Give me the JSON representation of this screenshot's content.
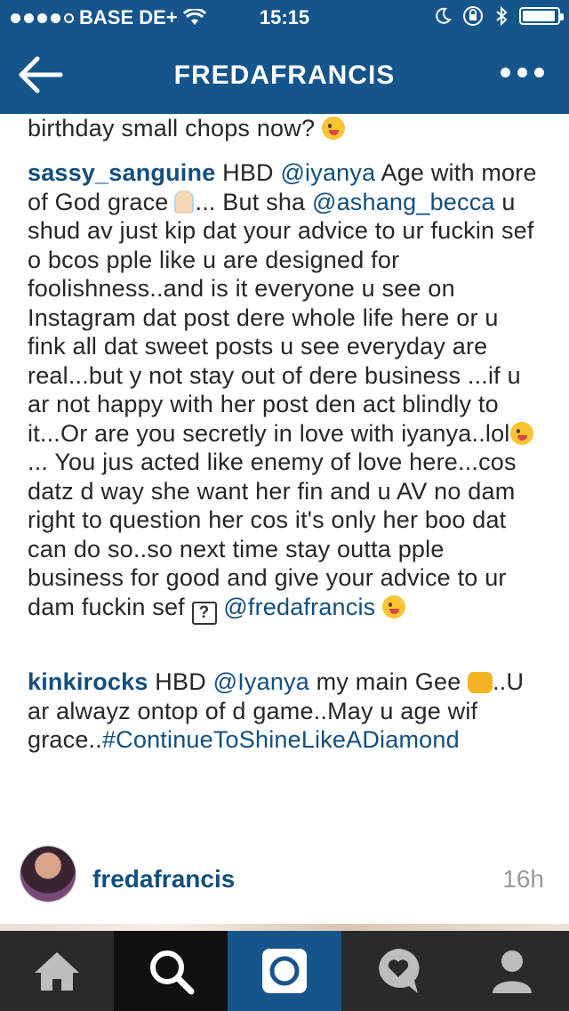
{
  "status_bar": {
    "carrier": "BASE DE+",
    "time": "15:15",
    "signal_bars": 4,
    "battery_level": 0.95
  },
  "nav": {
    "title": "FREDAFRANCIS",
    "back_icon": "arrow-left-icon",
    "more_icon": "more-dots-icon"
  },
  "comments": [
    {
      "text_before": "birthday small chops now?",
      "emoji": "winking-tongue-emoji"
    },
    {
      "username": "sassy_sanguine",
      "parts": {
        "a": "HBD ",
        "m1": "@iyanya",
        "b": " Age with more of God grace",
        "c": "... But sha ",
        "m2": "@ashang_becca",
        "d": " u shud av just kip dat your advice to ur fuckin sef o bcos pple like u are designed for foolishness..and is it everyone u see on Instagram dat post dere whole life here or u fink all dat sweet posts u see everyday are real...but y not stay out of dere business ...if u ar not happy with her post den act blindly to it...Or are you secretly in love with iyanya..lol",
        "e": "... You jus acted like enemy of love here...cos datz d way she want her fin and u AV no dam right to question her cos it's only her boo dat can do so..so next time stay outta pple business for good and give your advice to ur dam fuckin sef ",
        "q": "?",
        "m3": "@fredafrancis"
      }
    },
    {
      "username": "kinkirocks",
      "parts": {
        "a": "HBD ",
        "m1": "@Iyanya",
        "b": " my main Gee ",
        "c": "..U ar alwayz ontop of d game..May u age wif grace..",
        "tag": "#ContinueToShineLikeADiamond"
      }
    }
  ],
  "next_post": {
    "username": "fredafrancis",
    "age": "16h"
  },
  "tabbar": {
    "tabs": [
      {
        "name": "home",
        "icon": "home-icon"
      },
      {
        "name": "search",
        "icon": "search-icon"
      },
      {
        "name": "camera",
        "icon": "camera-icon"
      },
      {
        "name": "activity",
        "icon": "heart-bubble-icon"
      },
      {
        "name": "profile",
        "icon": "profile-icon"
      }
    ],
    "active": "search"
  },
  "colors": {
    "brand": "#15558c",
    "link": "#124e7e",
    "tabbar": "#2a2a2a"
  }
}
